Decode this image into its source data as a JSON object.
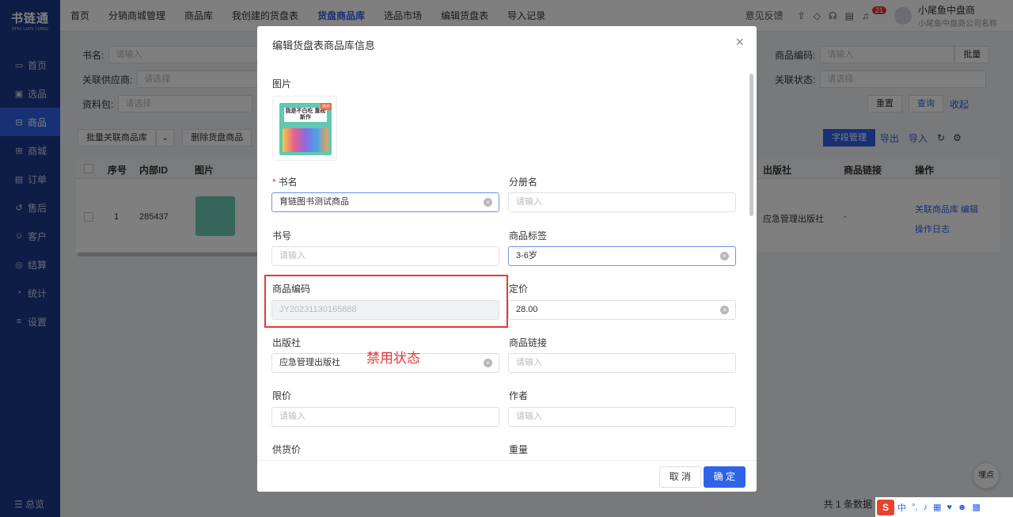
{
  "sidebar": {
    "logo_main": "书链通",
    "logo_sub": "SHU LIAN TONG",
    "items": [
      {
        "label": "首页",
        "icon": "monitor-icon"
      },
      {
        "label": "选品",
        "icon": "select-icon"
      },
      {
        "label": "商品",
        "icon": "goods-icon"
      },
      {
        "label": "商城",
        "icon": "mall-icon"
      },
      {
        "label": "订单",
        "icon": "order-icon"
      },
      {
        "label": "售后",
        "icon": "aftersale-icon"
      },
      {
        "label": "客户",
        "icon": "customer-icon"
      },
      {
        "label": "结算",
        "icon": "settle-icon"
      },
      {
        "label": "统计",
        "icon": "stats-icon"
      },
      {
        "label": "设置",
        "icon": "settings-icon"
      }
    ],
    "active": "商品",
    "bottom": "总览"
  },
  "topnav": {
    "items": [
      "首页",
      "分销商城管理",
      "商品库",
      "我创建的货盘表",
      "货盘商品库",
      "选品市场",
      "编辑货盘表",
      "导入记录"
    ],
    "active": "货盘商品库",
    "feedback": "意见反馈",
    "badge": "21",
    "user_name": "小尾鱼中盘商",
    "user_company": "小尾鱼中盘商公司名称"
  },
  "filters": {
    "book_name_label": "书名:",
    "book_name_placeholder": "请输入",
    "supplier_label": "关联供应商:",
    "supplier_placeholder": "请选择",
    "package_label": "资料包:",
    "package_placeholder": "请选择",
    "code_label": "商品编码:",
    "code_placeholder": "请输入",
    "batch_label": "批量",
    "status_label": "关联状态:",
    "status_placeholder": "请选择",
    "reset": "重置",
    "query": "查询",
    "collapse": "收起"
  },
  "toolbar": {
    "batch_link": "批量关联商品库",
    "delete": "删除货盘商品",
    "field_mgmt": "字段管理",
    "export": "导出",
    "import": "导入"
  },
  "table": {
    "headers": [
      "序号",
      "内部ID",
      "图片",
      "出版社",
      "商品链接",
      "操作"
    ],
    "row": {
      "index": "1",
      "id": "285437",
      "publisher": "应急管理出版社",
      "link": "-",
      "action_link": "关联商品库",
      "action_edit": "编辑",
      "action_log": "操作日志"
    }
  },
  "pager": {
    "total": "共 1 条数据"
  },
  "buried_point": "埋点",
  "ime": {
    "lang": "中"
  },
  "modal": {
    "title": "编辑货盘表商品库信息",
    "image_label": "图片",
    "cover_title": "我是不白吃 重磅新作",
    "cover_tag": "热卖",
    "fields": {
      "book_name": {
        "label": "书名",
        "value": "育链图书测试商品"
      },
      "volume_name": {
        "label": "分册名",
        "placeholder": "请输入"
      },
      "book_no": {
        "label": "书号",
        "placeholder": "请输入"
      },
      "tag": {
        "label": "商品标签",
        "value": "3-6岁"
      },
      "code": {
        "label": "商品编码",
        "value": "JY20231130165888"
      },
      "price": {
        "label": "定价",
        "value": "28.00"
      },
      "publisher": {
        "label": "出版社",
        "value": "应急管理出版社"
      },
      "product_link": {
        "label": "商品链接",
        "placeholder": "请输入"
      },
      "limit_price": {
        "label": "限价",
        "placeholder": "请输入"
      },
      "author": {
        "label": "作者",
        "placeholder": "请输入"
      },
      "supply_price": {
        "label": "供货价"
      },
      "weight": {
        "label": "重量"
      }
    },
    "annotation": "禁用状态",
    "cancel": "取 消",
    "ok": "确 定"
  }
}
